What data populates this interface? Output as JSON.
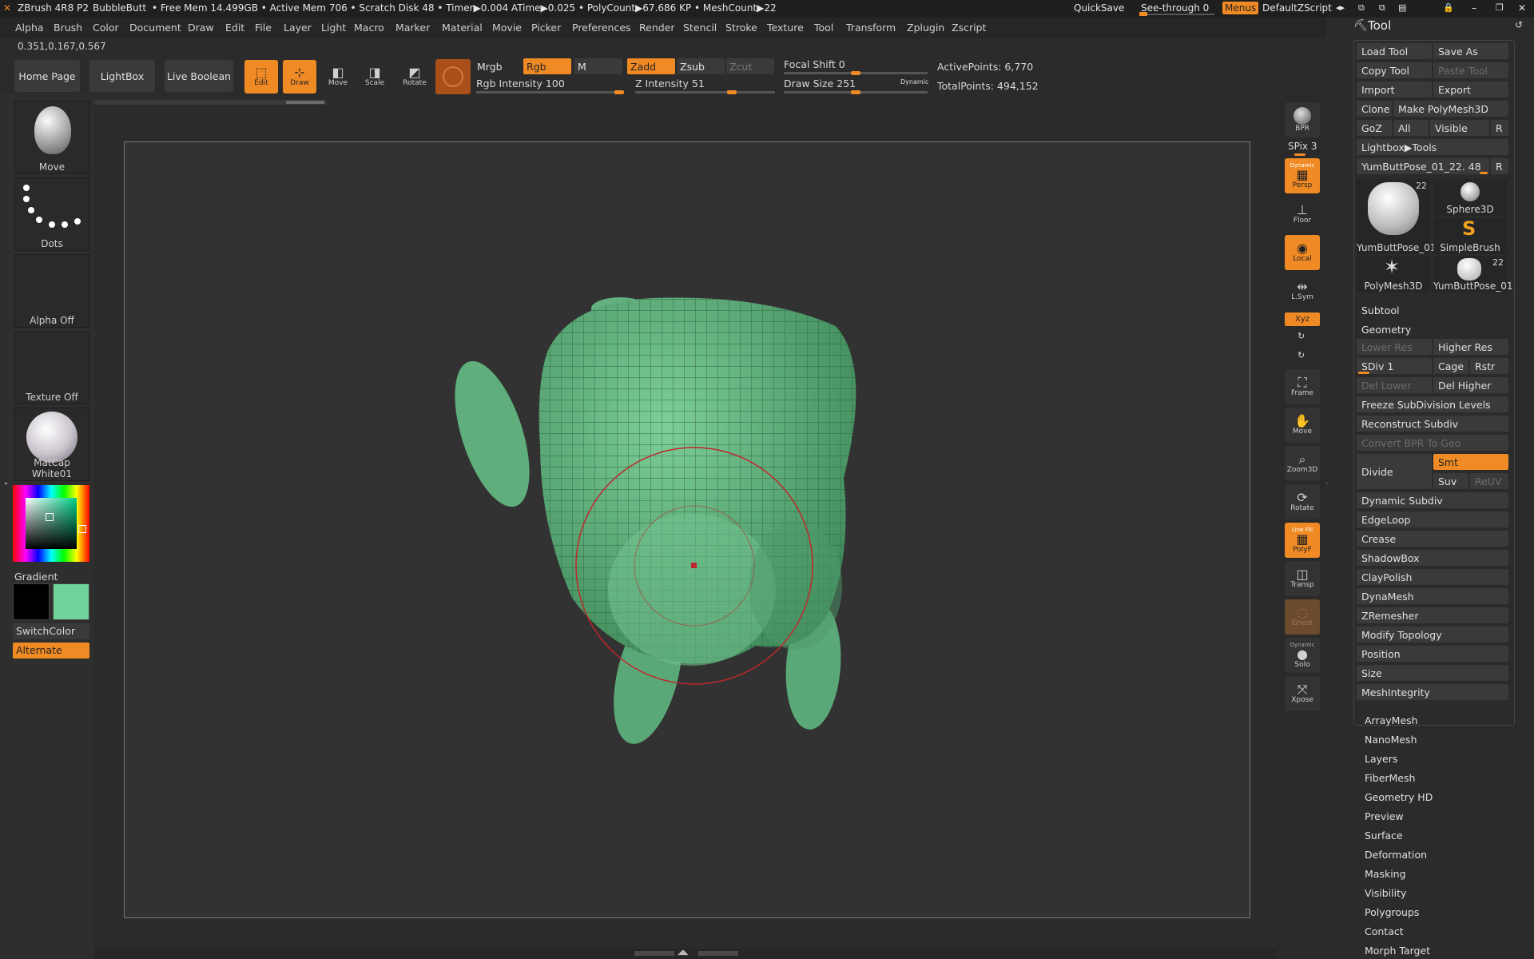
{
  "titlebar": {
    "app": "ZBrush 4R8 P2",
    "doc": "BubbleButt",
    "stats": "• Free Mem 14.499GB • Active Mem 706 • Scratch Disk 48 • Timer▶0.004 ATime▶0.025 • PolyCount▶67.686 KP • MeshCount▶22",
    "quicksave": "QuickSave",
    "seethrough": "See-through  0",
    "menus": "Menus",
    "script": "DefaultZScript"
  },
  "menubar": [
    "Alpha",
    "Brush",
    "Color",
    "Document",
    "Draw",
    "Edit",
    "File",
    "Layer",
    "Light",
    "Macro",
    "Marker",
    "Material",
    "Movie",
    "Picker",
    "Preferences",
    "Render",
    "Stencil",
    "Stroke",
    "Texture",
    "Tool",
    "Transform",
    "Zplugin",
    "Zscript"
  ],
  "coords": "0.351,0.167,0.567",
  "toolbar": {
    "home": "Home Page",
    "lightbox": "LightBox",
    "liveboolean": "Live Boolean",
    "edit": "Edit",
    "draw": "Draw",
    "move": "Move",
    "scale": "Scale",
    "rotate": "Rotate",
    "mrgb": "Mrgb",
    "rgb": "Rgb",
    "m": "M",
    "zadd": "Zadd",
    "zsub": "Zsub",
    "zcut": "Zcut",
    "rgb_intensity": "Rgb Intensity 100",
    "z_intensity": "Z Intensity 51",
    "focal_shift": "Focal Shift 0",
    "draw_size": "Draw Size 251",
    "dynamic": "Dynamic",
    "active_points": "ActivePoints: 6,770",
    "total_points": "TotalPoints: 494,152",
    "rgb_intensity_value": 100,
    "z_intensity_value": 51,
    "draw_size_value": 251
  },
  "leftpanel": {
    "brush": "Move",
    "stroke": "Dots",
    "alpha": "Alpha Off",
    "texture": "Texture Off",
    "material": "MatCap White01",
    "gradient": "Gradient",
    "switchcolor": "SwitchColor",
    "alternate": "Alternate",
    "main_color": "#000000",
    "secondary_color": "#6fd49a"
  },
  "rightshelf": {
    "bpr": "BPR",
    "spix": "SPix 3",
    "persp": "Persp",
    "persp_tag": "Dynamic",
    "floor": "Floor",
    "local": "Local",
    "lsym": "L.Sym",
    "xyz": "Xyz",
    "frame": "Frame",
    "move": "Move",
    "zoom3d": "Zoom3D",
    "rotate": "Rotate",
    "polyf": "PolyF",
    "polyf_tag": "Line Fill",
    "transp": "Transp",
    "ghost": "Ghost",
    "solo": "Solo",
    "solo_tag": "Dynamic",
    "xpose": "Xpose"
  },
  "toolpanel": {
    "title": "Tool",
    "load": "Load Tool",
    "saveas": "Save As",
    "copy": "Copy Tool",
    "paste": "Paste Tool",
    "import": "Import",
    "export": "Export",
    "clone": "Clone",
    "makepoly": "Make PolyMesh3D",
    "goz": "GoZ",
    "all": "All",
    "visible": "Visible",
    "r": "R",
    "lightboxtools": "Lightbox▶Tools",
    "current": "YumButtPose_01_22. 48",
    "thumbs": [
      {
        "label": "YumButtPose_01",
        "count": "22"
      },
      {
        "label": "Sphere3D"
      },
      {
        "label": "SimpleBrush"
      },
      {
        "label": "PolyMesh3D"
      },
      {
        "label": "YumButtPose_01",
        "count": "22"
      }
    ],
    "subtool": "Subtool",
    "geometry": "Geometry",
    "lowerres": "Lower Res",
    "higherres": "Higher Res",
    "sdiv": "SDiv 1",
    "cage": "Cage",
    "rstr": "Rstr",
    "dellower": "Del Lower",
    "delhigher": "Del Higher",
    "freeze": "Freeze SubDivision Levels",
    "reconstruct": "Reconstruct Subdiv",
    "convertbpr": "Convert BPR To Geo",
    "divide": "Divide",
    "smt": "Smt",
    "suv": "Suv",
    "reuv": "ReUV",
    "geo_items": [
      "Dynamic Subdiv",
      "EdgeLoop",
      "Crease",
      "ShadowBox",
      "ClayPolish",
      "DynaMesh",
      "ZRemesher",
      "Modify Topology",
      "Position",
      "Size",
      "MeshIntegrity"
    ],
    "sections": [
      "ArrayMesh",
      "NanoMesh",
      "Layers",
      "FiberMesh",
      "Geometry HD",
      "Preview",
      "Surface",
      "Deformation",
      "Masking",
      "Visibility",
      "Polygroups",
      "Contact",
      "Morph Target"
    ]
  }
}
